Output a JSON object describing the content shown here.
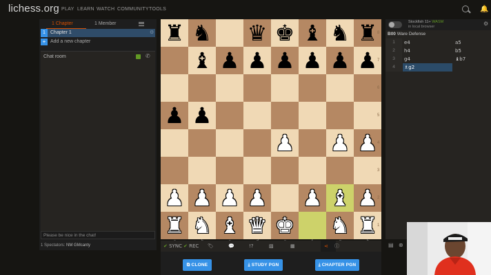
{
  "header": {
    "logo": "lichess.org",
    "nav": [
      "PLAY",
      "LEARN",
      "WATCH",
      "COMMUNITY",
      "TOOLS"
    ]
  },
  "study": {
    "tabs": {
      "chapters": "1 Chapter",
      "members": "1 Member"
    },
    "chapter": {
      "num": "1",
      "label": "Chapter 1"
    },
    "add_chapter": "Add a new chapter",
    "chat_title": "Chat room",
    "chat_placeholder": "Please be nice in the chat!",
    "spectators_prefix": "1 Spectators:",
    "spectators_name": "NM GMcanty"
  },
  "board": {
    "ranks": [
      "8",
      "7",
      "6",
      "5",
      "4",
      "3",
      "2",
      "1"
    ],
    "files": [
      "a",
      "b",
      "c",
      "d",
      "e",
      "f",
      "g",
      "h"
    ],
    "rows": [
      [
        "r",
        "n",
        "",
        "q",
        "k",
        "b",
        "n",
        "r"
      ],
      [
        "",
        "b",
        "p",
        "p",
        "p",
        "p",
        "p",
        "p"
      ],
      [
        "",
        "",
        "",
        "",
        "",
        "",
        "",
        ""
      ],
      [
        "p",
        "p",
        "",
        "",
        "",
        "",
        "",
        ""
      ],
      [
        "",
        "",
        "",
        "",
        "P",
        "",
        "P",
        "P"
      ],
      [
        "",
        "",
        "",
        "",
        "",
        "",
        "",
        ""
      ],
      [
        "P",
        "P",
        "P",
        "P",
        "",
        "P",
        "B",
        "P"
      ],
      [
        "R",
        "N",
        "B",
        "Q",
        "K",
        "",
        "N",
        "R"
      ]
    ],
    "last_move": [
      "f1",
      "g2"
    ]
  },
  "controls": {
    "sync": "SYNC",
    "rec": "REC",
    "icons": [
      "tag-icon",
      "comment-icon",
      "glyph-icon",
      "image-icon",
      "grid-icon",
      "share-icon",
      "info-icon"
    ],
    "glyph_text": "!?"
  },
  "buttons": {
    "clone": "CLONE",
    "study_pgn": "STUDY PGN",
    "chapter_pgn": "CHAPTER PGN"
  },
  "engine": {
    "name": "Stockfish 11+",
    "mode": "WASM",
    "sub": "in local browser"
  },
  "opening": {
    "eco": "B00",
    "name": "Ware Defense"
  },
  "moves": [
    {
      "n": "1",
      "w": "e4",
      "b": "a5"
    },
    {
      "n": "2",
      "w": "h4",
      "b": "b5"
    },
    {
      "n": "3",
      "w": "g4",
      "b": "♝b7"
    },
    {
      "n": "4",
      "w": "♗g2",
      "b": ""
    }
  ],
  "colors": {
    "accent": "#d85000",
    "blue": "#3692e7",
    "light_square": "#f0d9b5",
    "dark_square": "#b58863",
    "last_move": "#cdd26a",
    "green": "#629924"
  }
}
